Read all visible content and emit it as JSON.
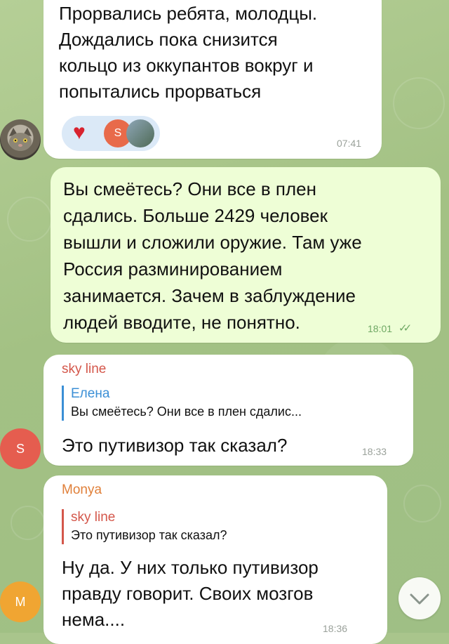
{
  "colors": {
    "in_bubble": "#ffffff",
    "out_bubble": "#eefed6",
    "sky_line": "#d4574b",
    "monya": "#e0803a",
    "elena": "#3b8fd6",
    "check": "#5fae5a"
  },
  "messages": [
    {
      "direction": "in",
      "lines": [
        "Прорвались ребята, молодцы.",
        "Дождались пока снизится",
        "кольцо из оккупантов вокруг и",
        "попытались прорваться"
      ],
      "time": "07:41",
      "reactions": {
        "emoji": "♥",
        "avatar_letter": "S"
      }
    },
    {
      "direction": "out",
      "lines": [
        "Вы смеётесь? Они все в плен",
        "сдались. Больше 2429 человек",
        "вышли и сложили оружие. Там уже",
        "Россия разминированием",
        "занимается. Зачем в заблуждение",
        "людей вводите, не понятно."
      ],
      "time": "18:01",
      "status": "✓✓"
    },
    {
      "direction": "in",
      "sender": "sky line",
      "reply": {
        "name": "Елена",
        "text": "Вы смеётесь? Они все в плен сдалис..."
      },
      "lines": [
        "Это путивизор так сказал?"
      ],
      "time": "18:33"
    },
    {
      "direction": "in",
      "sender": "Monya",
      "reply": {
        "name": "sky line",
        "text": "Это путивизор так сказал?"
      },
      "lines": [
        "Ну да. У них только путивизор",
        "правду говорит. Своих мозгов",
        "нема...."
      ],
      "time": "18:36"
    }
  ],
  "avatars": {
    "cat": "cat-avatar",
    "s": "S",
    "m": "M"
  },
  "scroll_icon": "chevron-down-icon"
}
